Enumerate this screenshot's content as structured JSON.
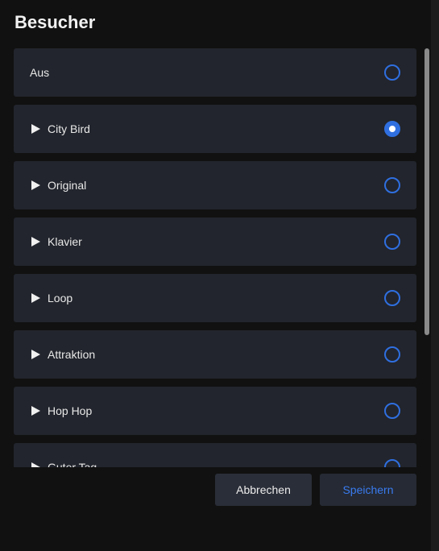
{
  "dialog": {
    "title": "Besucher",
    "options": [
      {
        "label": "Aus",
        "has_play": false,
        "selected": false
      },
      {
        "label": "City Bird",
        "has_play": true,
        "selected": true
      },
      {
        "label": "Original",
        "has_play": true,
        "selected": false
      },
      {
        "label": "Klavier",
        "has_play": true,
        "selected": false
      },
      {
        "label": "Loop",
        "has_play": true,
        "selected": false
      },
      {
        "label": "Attraktion",
        "has_play": true,
        "selected": false
      },
      {
        "label": "Hop Hop",
        "has_play": true,
        "selected": false
      },
      {
        "label": "Guter Tag",
        "has_play": true,
        "selected": false
      }
    ],
    "cancel_label": "Abbrechen",
    "save_label": "Speichern"
  },
  "colors": {
    "accent": "#2f6fe0",
    "item_background": "#22252d",
    "dialog_background": "#111111",
    "text": "#e8e8e8"
  },
  "icons": {
    "play": "play-icon",
    "radio": "radio-icon"
  }
}
